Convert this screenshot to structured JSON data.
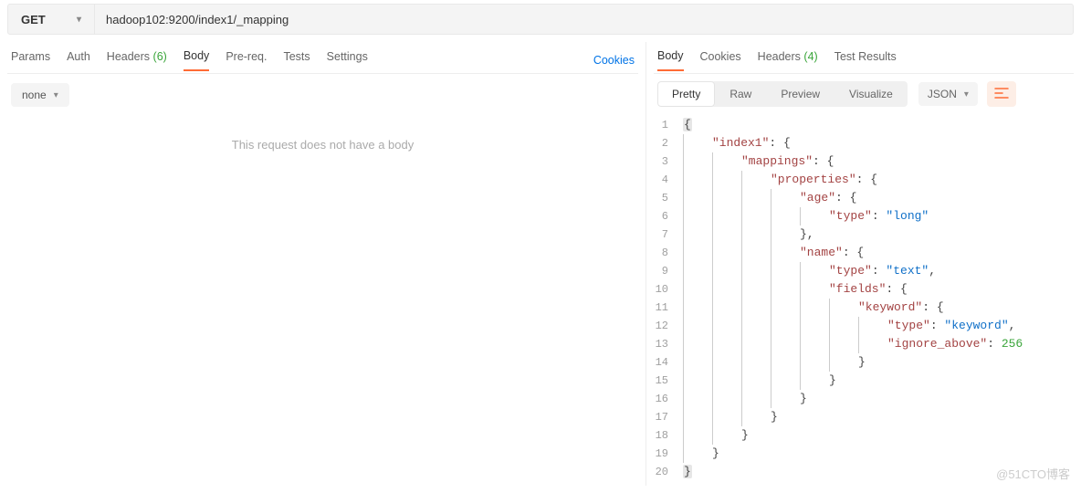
{
  "request": {
    "method": "GET",
    "url": "hadoop102:9200/index1/_mapping"
  },
  "left_tabs": {
    "items": [
      "Params",
      "Auth",
      "Headers",
      "Body",
      "Pre-req.",
      "Tests",
      "Settings"
    ],
    "headers_count": "(6)",
    "active": "Body",
    "cookies_link": "Cookies"
  },
  "body_type": "none",
  "empty_body_msg": "This request does not have a body",
  "right_tabs": {
    "items": [
      "Body",
      "Cookies",
      "Headers",
      "Test Results"
    ],
    "headers_count": "(4)",
    "active": "Body"
  },
  "view_tabs": {
    "items": [
      "Pretty",
      "Raw",
      "Preview",
      "Visualize"
    ],
    "active": "Pretty"
  },
  "format": "JSON",
  "code_lines": [
    {
      "n": 1,
      "tokens": [
        {
          "c": "p",
          "t": "{",
          "hl": true
        }
      ]
    },
    {
      "n": 2,
      "indent": 1,
      "tokens": [
        {
          "c": "k",
          "t": "\"index1\""
        },
        {
          "c": "p",
          "t": ": "
        },
        {
          "c": "p",
          "t": "{"
        }
      ]
    },
    {
      "n": 3,
      "indent": 2,
      "tokens": [
        {
          "c": "k",
          "t": "\"mappings\""
        },
        {
          "c": "p",
          "t": ": "
        },
        {
          "c": "p",
          "t": "{"
        }
      ]
    },
    {
      "n": 4,
      "indent": 3,
      "tokens": [
        {
          "c": "k",
          "t": "\"properties\""
        },
        {
          "c": "p",
          "t": ": "
        },
        {
          "c": "p",
          "t": "{"
        }
      ]
    },
    {
      "n": 5,
      "indent": 4,
      "tokens": [
        {
          "c": "k",
          "t": "\"age\""
        },
        {
          "c": "p",
          "t": ": "
        },
        {
          "c": "p",
          "t": "{"
        }
      ]
    },
    {
      "n": 6,
      "indent": 5,
      "tokens": [
        {
          "c": "k",
          "t": "\"type\""
        },
        {
          "c": "p",
          "t": ": "
        },
        {
          "c": "s",
          "t": "\"long\""
        }
      ]
    },
    {
      "n": 7,
      "indent": 4,
      "tokens": [
        {
          "c": "p",
          "t": "},"
        }
      ]
    },
    {
      "n": 8,
      "indent": 4,
      "tokens": [
        {
          "c": "k",
          "t": "\"name\""
        },
        {
          "c": "p",
          "t": ": "
        },
        {
          "c": "p",
          "t": "{"
        }
      ]
    },
    {
      "n": 9,
      "indent": 5,
      "tokens": [
        {
          "c": "k",
          "t": "\"type\""
        },
        {
          "c": "p",
          "t": ": "
        },
        {
          "c": "s",
          "t": "\"text\""
        },
        {
          "c": "p",
          "t": ","
        }
      ]
    },
    {
      "n": 10,
      "indent": 5,
      "tokens": [
        {
          "c": "k",
          "t": "\"fields\""
        },
        {
          "c": "p",
          "t": ": "
        },
        {
          "c": "p",
          "t": "{"
        }
      ]
    },
    {
      "n": 11,
      "indent": 6,
      "tokens": [
        {
          "c": "k",
          "t": "\"keyword\""
        },
        {
          "c": "p",
          "t": ": "
        },
        {
          "c": "p",
          "t": "{"
        }
      ]
    },
    {
      "n": 12,
      "indent": 7,
      "tokens": [
        {
          "c": "k",
          "t": "\"type\""
        },
        {
          "c": "p",
          "t": ": "
        },
        {
          "c": "s",
          "t": "\"keyword\""
        },
        {
          "c": "p",
          "t": ","
        }
      ]
    },
    {
      "n": 13,
      "indent": 7,
      "tokens": [
        {
          "c": "k",
          "t": "\"ignore_above\""
        },
        {
          "c": "p",
          "t": ": "
        },
        {
          "c": "n",
          "t": "256"
        }
      ]
    },
    {
      "n": 14,
      "indent": 6,
      "tokens": [
        {
          "c": "p",
          "t": "}"
        }
      ]
    },
    {
      "n": 15,
      "indent": 5,
      "tokens": [
        {
          "c": "p",
          "t": "}"
        }
      ]
    },
    {
      "n": 16,
      "indent": 4,
      "tokens": [
        {
          "c": "p",
          "t": "}"
        }
      ]
    },
    {
      "n": 17,
      "indent": 3,
      "tokens": [
        {
          "c": "p",
          "t": "}"
        }
      ]
    },
    {
      "n": 18,
      "indent": 2,
      "tokens": [
        {
          "c": "p",
          "t": "}"
        }
      ]
    },
    {
      "n": 19,
      "indent": 1,
      "tokens": [
        {
          "c": "p",
          "t": "}"
        }
      ]
    },
    {
      "n": 20,
      "tokens": [
        {
          "c": "p",
          "t": "}",
          "hl": true
        }
      ]
    }
  ],
  "watermark": "@51CTO博客"
}
